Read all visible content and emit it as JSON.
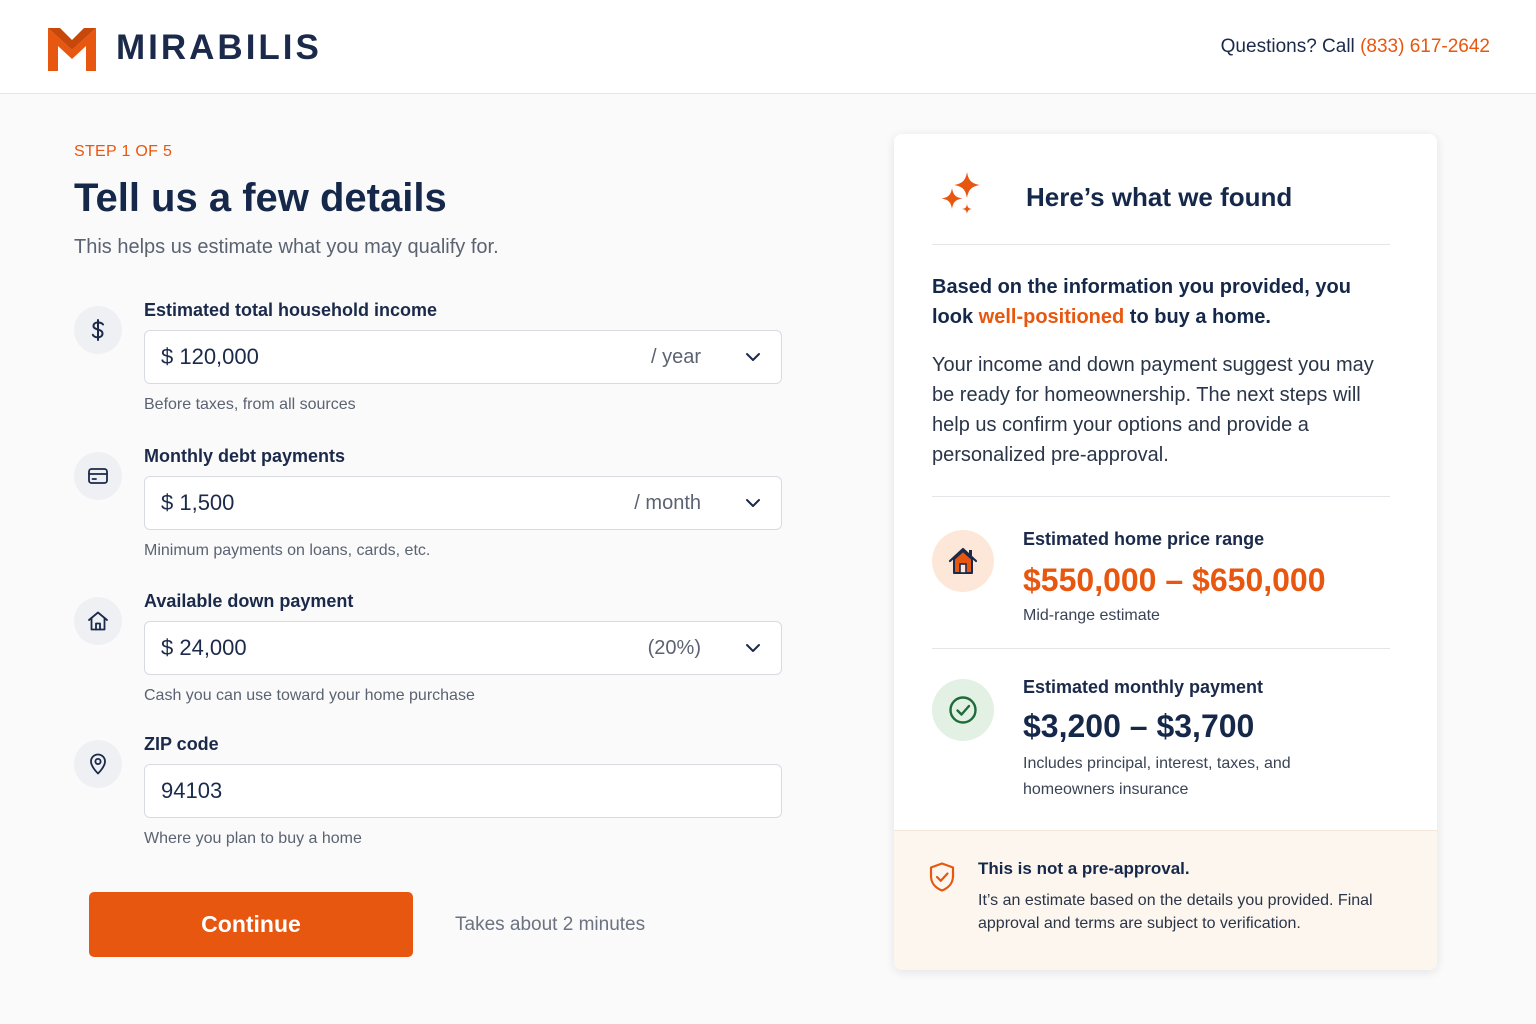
{
  "header": {
    "brand": "MIRABILIS",
    "contact_prefix": "Questions? Call ",
    "phone": "(833) 617-2642"
  },
  "form": {
    "step": "STEP 1 OF 5",
    "title": "Tell us a few details",
    "subtitle": "This helps us estimate what you may qualify for.",
    "fields": [
      {
        "icon": "dollar-icon",
        "label": "Estimated total household income",
        "value": "$  120,000",
        "unit": "/ year",
        "help": "Before taxes, from all sources"
      },
      {
        "icon": "credit-card-icon",
        "label": "Monthly debt payments",
        "value": "$  1,500",
        "unit": "/ month",
        "help": "Minimum payments on loans, cards, etc."
      },
      {
        "icon": "home-icon",
        "label": "Available down payment",
        "value": "$  24,000",
        "unit": "(20%)",
        "help": "Cash you can use toward your home purchase"
      },
      {
        "icon": "map-pin-icon",
        "label": "ZIP code",
        "value": "94103",
        "help": "Where you plan to buy a home"
      }
    ],
    "continue_label": "Continue",
    "duration": "Takes about 2 minutes"
  },
  "results": {
    "title": "Here’s what we found",
    "lead_prefix": "Based on the information you provided, you look ",
    "lead_highlight": "well-positioned",
    "lead_suffix": " to buy a home.",
    "body": "Your income and down payment suggest you may be ready for homeownership. The next steps will help us confirm your options and provide a personalized pre-approval.",
    "price_range": {
      "label": "Estimated home price range",
      "value": "$550,000 – $650,000",
      "note": "Mid-range estimate"
    },
    "monthly_payment": {
      "label": "Estimated monthly payment",
      "value": "$3,200 – $3,700",
      "note": "Includes principal, interest, taxes, and homeowners insurance"
    },
    "disclaimer": {
      "title": "This is not a pre-approval.",
      "text": "It’s an estimate based on the details you provided. Final approval and terms are subject to verification."
    }
  },
  "colors": {
    "accent": "#e8570f",
    "navy": "#15284a",
    "success": "#1f6b3a",
    "disclaimer_bg": "#fdf6ef"
  }
}
